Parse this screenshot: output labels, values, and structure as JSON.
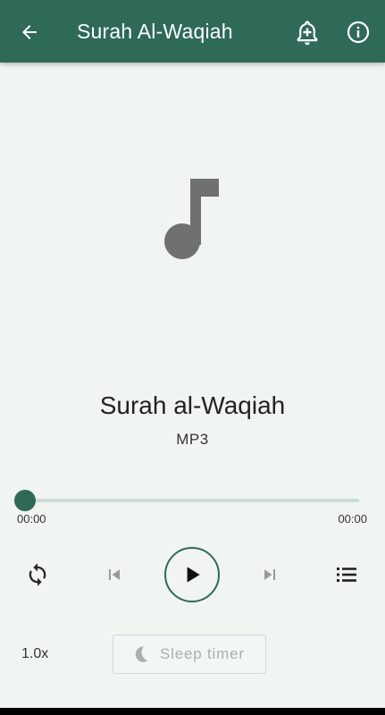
{
  "appbar": {
    "title": "Surah Al-Waqiah",
    "back_icon": "arrow-left-icon",
    "bell_icon": "bell-plus-icon",
    "info_icon": "info-circle-icon"
  },
  "track": {
    "title": "Surah al-Waqiah",
    "format": "MP3",
    "artwork_icon": "music-note-icon"
  },
  "progress": {
    "current": "00:00",
    "total": "00:00",
    "fraction": 0
  },
  "controls": {
    "repeat_icon": "repeat-icon",
    "prev_icon": "skip-previous-icon",
    "play_icon": "play-icon",
    "next_icon": "skip-next-icon",
    "playlist_icon": "playlist-icon"
  },
  "speed": "1.0x",
  "sleep_timer": {
    "label": "Sleep timer",
    "icon": "moon-icon"
  },
  "colors": {
    "primary": "#2e6a57",
    "background": "#f0f5f2",
    "track": "#c9dcd5"
  }
}
